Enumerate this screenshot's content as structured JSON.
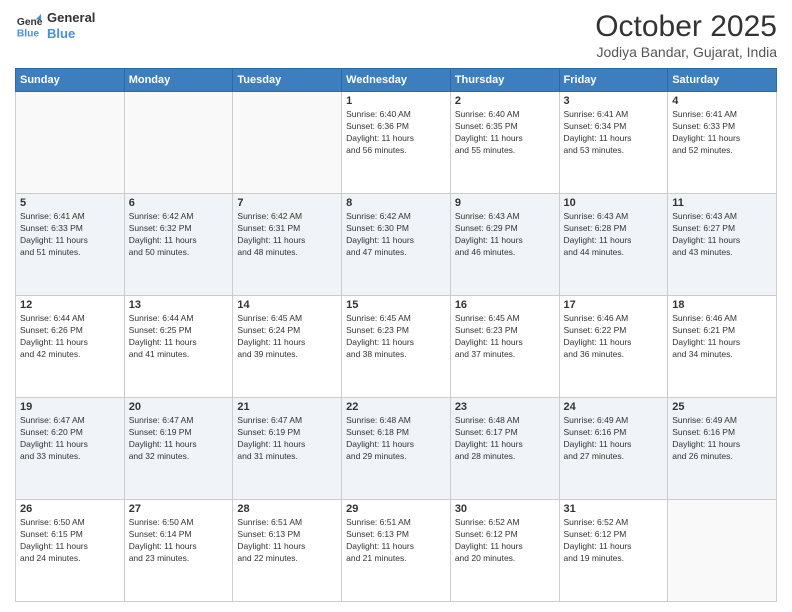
{
  "header": {
    "logo_line1": "General",
    "logo_line2": "Blue",
    "month_title": "October 2025",
    "location": "Jodiya Bandar, Gujarat, India"
  },
  "weekdays": [
    "Sunday",
    "Monday",
    "Tuesday",
    "Wednesday",
    "Thursday",
    "Friday",
    "Saturday"
  ],
  "weeks": [
    [
      {
        "day": "",
        "info": ""
      },
      {
        "day": "",
        "info": ""
      },
      {
        "day": "",
        "info": ""
      },
      {
        "day": "1",
        "info": "Sunrise: 6:40 AM\nSunset: 6:36 PM\nDaylight: 11 hours\nand 56 minutes."
      },
      {
        "day": "2",
        "info": "Sunrise: 6:40 AM\nSunset: 6:35 PM\nDaylight: 11 hours\nand 55 minutes."
      },
      {
        "day": "3",
        "info": "Sunrise: 6:41 AM\nSunset: 6:34 PM\nDaylight: 11 hours\nand 53 minutes."
      },
      {
        "day": "4",
        "info": "Sunrise: 6:41 AM\nSunset: 6:33 PM\nDaylight: 11 hours\nand 52 minutes."
      }
    ],
    [
      {
        "day": "5",
        "info": "Sunrise: 6:41 AM\nSunset: 6:33 PM\nDaylight: 11 hours\nand 51 minutes."
      },
      {
        "day": "6",
        "info": "Sunrise: 6:42 AM\nSunset: 6:32 PM\nDaylight: 11 hours\nand 50 minutes."
      },
      {
        "day": "7",
        "info": "Sunrise: 6:42 AM\nSunset: 6:31 PM\nDaylight: 11 hours\nand 48 minutes."
      },
      {
        "day": "8",
        "info": "Sunrise: 6:42 AM\nSunset: 6:30 PM\nDaylight: 11 hours\nand 47 minutes."
      },
      {
        "day": "9",
        "info": "Sunrise: 6:43 AM\nSunset: 6:29 PM\nDaylight: 11 hours\nand 46 minutes."
      },
      {
        "day": "10",
        "info": "Sunrise: 6:43 AM\nSunset: 6:28 PM\nDaylight: 11 hours\nand 44 minutes."
      },
      {
        "day": "11",
        "info": "Sunrise: 6:43 AM\nSunset: 6:27 PM\nDaylight: 11 hours\nand 43 minutes."
      }
    ],
    [
      {
        "day": "12",
        "info": "Sunrise: 6:44 AM\nSunset: 6:26 PM\nDaylight: 11 hours\nand 42 minutes."
      },
      {
        "day": "13",
        "info": "Sunrise: 6:44 AM\nSunset: 6:25 PM\nDaylight: 11 hours\nand 41 minutes."
      },
      {
        "day": "14",
        "info": "Sunrise: 6:45 AM\nSunset: 6:24 PM\nDaylight: 11 hours\nand 39 minutes."
      },
      {
        "day": "15",
        "info": "Sunrise: 6:45 AM\nSunset: 6:23 PM\nDaylight: 11 hours\nand 38 minutes."
      },
      {
        "day": "16",
        "info": "Sunrise: 6:45 AM\nSunset: 6:23 PM\nDaylight: 11 hours\nand 37 minutes."
      },
      {
        "day": "17",
        "info": "Sunrise: 6:46 AM\nSunset: 6:22 PM\nDaylight: 11 hours\nand 36 minutes."
      },
      {
        "day": "18",
        "info": "Sunrise: 6:46 AM\nSunset: 6:21 PM\nDaylight: 11 hours\nand 34 minutes."
      }
    ],
    [
      {
        "day": "19",
        "info": "Sunrise: 6:47 AM\nSunset: 6:20 PM\nDaylight: 11 hours\nand 33 minutes."
      },
      {
        "day": "20",
        "info": "Sunrise: 6:47 AM\nSunset: 6:19 PM\nDaylight: 11 hours\nand 32 minutes."
      },
      {
        "day": "21",
        "info": "Sunrise: 6:47 AM\nSunset: 6:19 PM\nDaylight: 11 hours\nand 31 minutes."
      },
      {
        "day": "22",
        "info": "Sunrise: 6:48 AM\nSunset: 6:18 PM\nDaylight: 11 hours\nand 29 minutes."
      },
      {
        "day": "23",
        "info": "Sunrise: 6:48 AM\nSunset: 6:17 PM\nDaylight: 11 hours\nand 28 minutes."
      },
      {
        "day": "24",
        "info": "Sunrise: 6:49 AM\nSunset: 6:16 PM\nDaylight: 11 hours\nand 27 minutes."
      },
      {
        "day": "25",
        "info": "Sunrise: 6:49 AM\nSunset: 6:16 PM\nDaylight: 11 hours\nand 26 minutes."
      }
    ],
    [
      {
        "day": "26",
        "info": "Sunrise: 6:50 AM\nSunset: 6:15 PM\nDaylight: 11 hours\nand 24 minutes."
      },
      {
        "day": "27",
        "info": "Sunrise: 6:50 AM\nSunset: 6:14 PM\nDaylight: 11 hours\nand 23 minutes."
      },
      {
        "day": "28",
        "info": "Sunrise: 6:51 AM\nSunset: 6:13 PM\nDaylight: 11 hours\nand 22 minutes."
      },
      {
        "day": "29",
        "info": "Sunrise: 6:51 AM\nSunset: 6:13 PM\nDaylight: 11 hours\nand 21 minutes."
      },
      {
        "day": "30",
        "info": "Sunrise: 6:52 AM\nSunset: 6:12 PM\nDaylight: 11 hours\nand 20 minutes."
      },
      {
        "day": "31",
        "info": "Sunrise: 6:52 AM\nSunset: 6:12 PM\nDaylight: 11 hours\nand 19 minutes."
      },
      {
        "day": "",
        "info": ""
      }
    ]
  ]
}
